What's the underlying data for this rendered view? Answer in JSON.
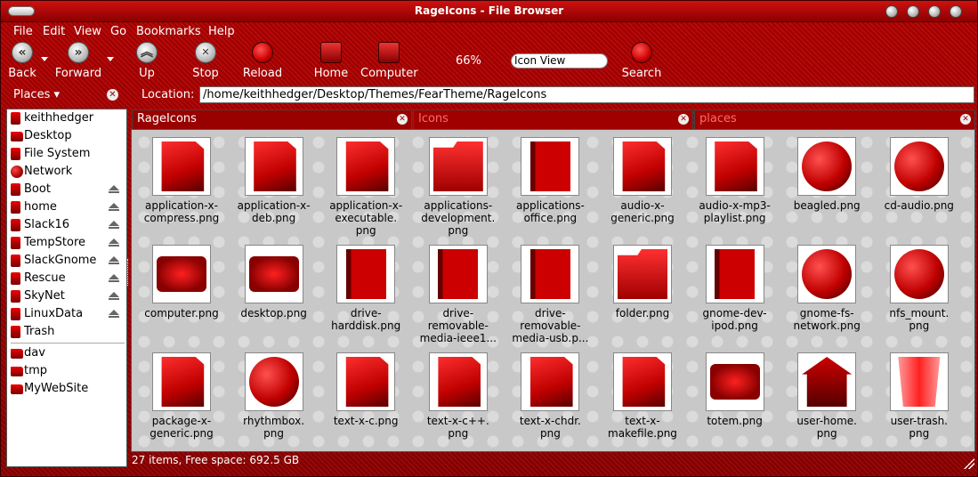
{
  "window": {
    "title": "RageIcons - File Browser"
  },
  "menu": [
    "File",
    "Edit",
    "View",
    "Go",
    "Bookmarks",
    "Help"
  ],
  "toolbar": {
    "back": "Back",
    "forward": "Forward",
    "up": "Up",
    "stop": "Stop",
    "reload": "Reload",
    "home": "Home",
    "computer": "Computer",
    "zoom": "66%",
    "view_mode": "Icon View",
    "search": "Search"
  },
  "places": {
    "header": "Places"
  },
  "location": {
    "label": "Location:",
    "path": "/home/keithhedger/Desktop/Themes/FearTheme/RageIcons"
  },
  "sidebar": {
    "items": [
      {
        "label": "keithhedger",
        "icon": "home-icon",
        "eject": false
      },
      {
        "label": "Desktop",
        "icon": "desktop-icon",
        "eject": false
      },
      {
        "label": "File System",
        "icon": "drive-icon",
        "eject": false
      },
      {
        "label": "Network",
        "icon": "network-icon",
        "eject": false
      },
      {
        "label": "Boot",
        "icon": "drive-icon",
        "eject": true
      },
      {
        "label": "home",
        "icon": "drive-icon",
        "eject": true
      },
      {
        "label": "Slack16",
        "icon": "drive-icon",
        "eject": true
      },
      {
        "label": "TempStore",
        "icon": "drive-icon",
        "eject": true
      },
      {
        "label": "SlackGnome",
        "icon": "drive-icon",
        "eject": true
      },
      {
        "label": "Rescue",
        "icon": "drive-icon",
        "eject": true
      },
      {
        "label": "SkyNet",
        "icon": "drive-icon",
        "eject": true
      },
      {
        "label": "LinuxData",
        "icon": "drive-icon",
        "eject": true
      },
      {
        "label": "Trash",
        "icon": "trash-icon",
        "eject": false
      }
    ],
    "bookmarks": [
      {
        "label": "dav",
        "icon": "folder-icon"
      },
      {
        "label": "tmp",
        "icon": "folder-icon"
      },
      {
        "label": "MyWebSite",
        "icon": "folder-icon"
      }
    ]
  },
  "tabs": [
    "RageIcons",
    "Icons",
    "places"
  ],
  "files": [
    {
      "name": "application-x-compress.png",
      "lines": [
        "application-x-",
        "compress.png"
      ],
      "art": "page"
    },
    {
      "name": "application-x-deb.png",
      "lines": [
        "application-x-",
        "deb.png"
      ],
      "art": "page"
    },
    {
      "name": "application-x-executable.png",
      "lines": [
        "application-x-",
        "executable.",
        "png"
      ],
      "art": "page"
    },
    {
      "name": "applications-development.png",
      "lines": [
        "applications-",
        "development.",
        "png"
      ],
      "art": "folderart"
    },
    {
      "name": "applications-office.png",
      "lines": [
        "applications-",
        "office.png"
      ],
      "art": "book"
    },
    {
      "name": "audio-x-generic.png",
      "lines": [
        "audio-x-",
        "generic.png"
      ],
      "art": "page"
    },
    {
      "name": "audio-x-mp3-playlist.png",
      "lines": [
        "audio-x-mp3-",
        "playlist.png"
      ],
      "art": "page"
    },
    {
      "name": "beagled.png",
      "lines": [
        "beagled.png"
      ],
      "art": "round"
    },
    {
      "name": "cd-audio.png",
      "lines": [
        "cd-audio.png"
      ],
      "art": "round"
    },
    {
      "name": "computer.png",
      "lines": [
        "computer.png"
      ],
      "art": "screen"
    },
    {
      "name": "desktop.png",
      "lines": [
        "desktop.png"
      ],
      "art": "screen"
    },
    {
      "name": "drive-harddisk.png",
      "lines": [
        "drive-",
        "harddisk.png"
      ],
      "art": "book"
    },
    {
      "name": "drive-removable-media-ieee1...",
      "lines": [
        "drive-",
        "removable-",
        "media-ieee1..."
      ],
      "art": "book"
    },
    {
      "name": "drive-removable-media-usb.p...",
      "lines": [
        "drive-",
        "removable-",
        "media-usb.p..."
      ],
      "art": "book"
    },
    {
      "name": "folder.png",
      "lines": [
        "folder.png"
      ],
      "art": "folderart"
    },
    {
      "name": "gnome-dev-ipod.png",
      "lines": [
        "gnome-dev-",
        "ipod.png"
      ],
      "art": "book"
    },
    {
      "name": "gnome-fs-network.png",
      "lines": [
        "gnome-fs-",
        "network.png"
      ],
      "art": "round"
    },
    {
      "name": "nfs_mount.png",
      "lines": [
        "nfs_mount.",
        "png"
      ],
      "art": "round"
    },
    {
      "name": "package-x-generic.png",
      "lines": [
        "package-x-",
        "generic.png"
      ],
      "art": "page"
    },
    {
      "name": "rhythmbox.png",
      "lines": [
        "rhythmbox.",
        "png"
      ],
      "art": "round"
    },
    {
      "name": "text-x-c.png",
      "lines": [
        "text-x-c.png"
      ],
      "art": "page"
    },
    {
      "name": "text-x-c++.png",
      "lines": [
        "text-x-c++.",
        "png"
      ],
      "art": "page"
    },
    {
      "name": "text-x-chdr.png",
      "lines": [
        "text-x-chdr.",
        "png"
      ],
      "art": "page"
    },
    {
      "name": "text-x-makefile.png",
      "lines": [
        "text-x-",
        "makefile.png"
      ],
      "art": "page"
    },
    {
      "name": "totem.png",
      "lines": [
        "totem.png"
      ],
      "art": "screen"
    },
    {
      "name": "user-home.png",
      "lines": [
        "user-home.",
        "png"
      ],
      "art": "house"
    },
    {
      "name": "user-trash.png",
      "lines": [
        "user-trash.",
        "png"
      ],
      "art": "bin"
    }
  ],
  "status": {
    "text": "27 items, Free space: 692.5 GB"
  }
}
